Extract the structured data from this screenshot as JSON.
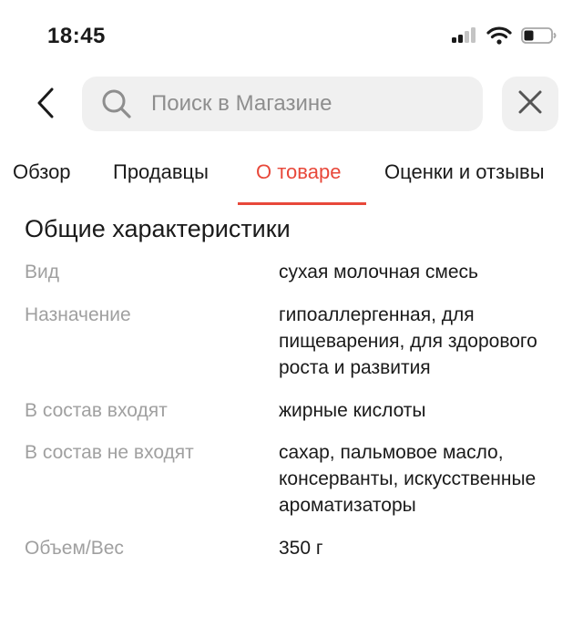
{
  "status_bar": {
    "time": "18:45",
    "icons": [
      "cellular-signal-icon",
      "wifi-icon",
      "battery-icon"
    ]
  },
  "header": {
    "back_icon": "chevron-left-icon",
    "search": {
      "placeholder": "Поиск в Магазине",
      "value": ""
    },
    "clear_icon": "close-icon"
  },
  "tabs": [
    {
      "label": "Обзор",
      "active": false
    },
    {
      "label": "Продавцы",
      "active": false
    },
    {
      "label": "О товаре",
      "active": true
    },
    {
      "label": "Оценки и отзывы",
      "active": false
    }
  ],
  "section": {
    "title": "Общие характеристики",
    "rows": [
      {
        "label": "Вид",
        "value": "сухая молочная смесь"
      },
      {
        "label": "Назначение",
        "value": "гипоаллергенная, для пищеварения, для здорового роста и развития"
      },
      {
        "label": "В состав входят",
        "value": "жирные кислоты"
      },
      {
        "label": "В состав не входят",
        "value": "сахар, пальмовое масло, консерванты, искусственные ароматизаторы"
      },
      {
        "label": "Объем/Вес",
        "value": "350 г"
      }
    ]
  },
  "colors": {
    "accent": "#e8483a",
    "label_gray": "#a0a0a0",
    "field_bg": "#f0f0f0"
  }
}
